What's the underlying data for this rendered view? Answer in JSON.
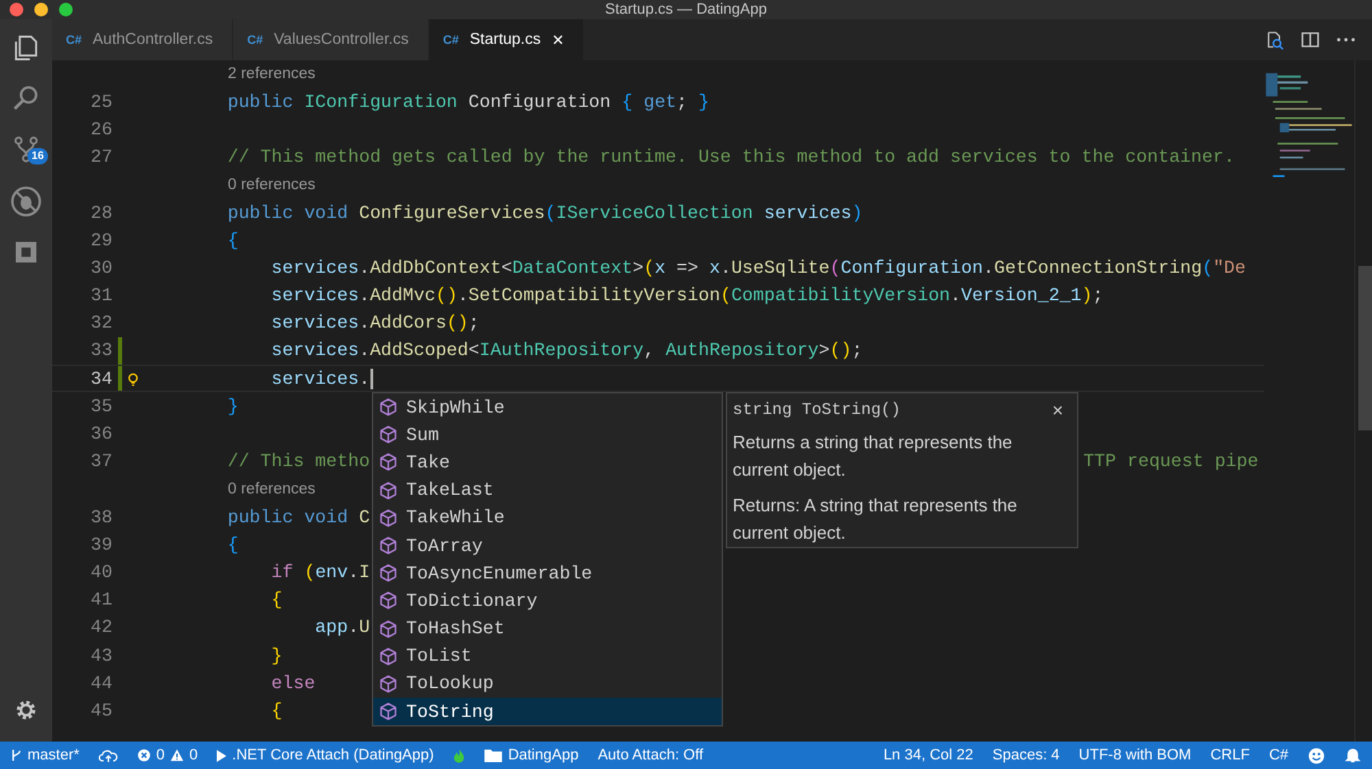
{
  "window": {
    "title": "Startup.cs — DatingApp"
  },
  "activity_bar": {
    "source_control_badge": "16"
  },
  "tabs": [
    {
      "icon": "C#",
      "label": "AuthController.cs",
      "selected": false
    },
    {
      "icon": "C#",
      "label": "ValuesController.cs",
      "selected": false
    },
    {
      "icon": "C#",
      "label": "Startup.cs",
      "selected": true,
      "close": "✕"
    }
  ],
  "editor": {
    "lines": [
      {
        "kind": "codelens",
        "text": "2 references"
      },
      {
        "kind": "code",
        "number": "25",
        "current": false,
        "changed": false,
        "tokens": [
          {
            "text": "        public ",
            "kind": "keyword"
          },
          {
            "text": "IConfiguration",
            "kind": "type"
          },
          {
            "text": " Configuration ",
            "kind": "plain"
          },
          {
            "text": "{",
            "kind": "brace3"
          },
          {
            "text": " get",
            "kind": "keyword"
          },
          {
            "text": "; ",
            "kind": "plain"
          },
          {
            "text": "}",
            "kind": "brace3"
          }
        ]
      },
      {
        "kind": "code",
        "number": "26",
        "current": false,
        "changed": false
      },
      {
        "kind": "code",
        "number": "27",
        "current": false,
        "changed": false,
        "tokens": [
          {
            "text": "        // This method gets called by the runtime. Use this method to add services to the container.",
            "kind": "comment"
          }
        ]
      },
      {
        "kind": "codelens",
        "text": "0 references"
      },
      {
        "kind": "code",
        "number": "28",
        "current": false,
        "changed": false,
        "tokens": [
          {
            "text": "        public void ",
            "kind": "keyword"
          },
          {
            "text": "ConfigureServices",
            "kind": "function"
          },
          {
            "text": "(",
            "kind": "brace3"
          },
          {
            "text": "IServiceCollection",
            "kind": "type"
          },
          {
            "text": " services",
            "kind": "variable"
          },
          {
            "text": ")",
            "kind": "brace3"
          }
        ]
      },
      {
        "kind": "code",
        "number": "29",
        "current": false,
        "changed": false,
        "tokens": [
          {
            "text": "        {",
            "kind": "brace3"
          }
        ]
      },
      {
        "kind": "code",
        "number": "30",
        "current": false,
        "changed": false,
        "tokens": [
          {
            "text": "            services",
            "kind": "variable"
          },
          {
            "text": ".",
            "kind": "plain"
          },
          {
            "text": "AddDbContext",
            "kind": "function"
          },
          {
            "text": "<",
            "kind": "plain"
          },
          {
            "text": "DataContext",
            "kind": "type"
          },
          {
            "text": ">",
            "kind": "plain"
          },
          {
            "text": "(",
            "kind": "brace1"
          },
          {
            "text": "x",
            "kind": "variable"
          },
          {
            "text": " => ",
            "kind": "plain"
          },
          {
            "text": "x",
            "kind": "variable"
          },
          {
            "text": ".",
            "kind": "plain"
          },
          {
            "text": "UseSqlite",
            "kind": "function"
          },
          {
            "text": "(",
            "kind": "brace2"
          },
          {
            "text": "Configuration",
            "kind": "variable"
          },
          {
            "text": ".",
            "kind": "plain"
          },
          {
            "text": "GetConnectionString",
            "kind": "function"
          },
          {
            "text": "(",
            "kind": "brace3"
          },
          {
            "text": "\"De",
            "kind": "string"
          }
        ]
      },
      {
        "kind": "code",
        "number": "31",
        "current": false,
        "changed": false,
        "tokens": [
          {
            "text": "            services",
            "kind": "variable"
          },
          {
            "text": ".",
            "kind": "plain"
          },
          {
            "text": "AddMvc",
            "kind": "function"
          },
          {
            "text": "()",
            "kind": "brace1"
          },
          {
            "text": ".",
            "kind": "plain"
          },
          {
            "text": "SetCompatibilityVersion",
            "kind": "function"
          },
          {
            "text": "(",
            "kind": "brace1"
          },
          {
            "text": "CompatibilityVersion",
            "kind": "type"
          },
          {
            "text": ".",
            "kind": "plain"
          },
          {
            "text": "Version_2_1",
            "kind": "variable"
          },
          {
            "text": ")",
            "kind": "brace1"
          },
          {
            "text": ";",
            "kind": "plain"
          }
        ]
      },
      {
        "kind": "code",
        "number": "32",
        "current": false,
        "changed": false,
        "tokens": [
          {
            "text": "            services",
            "kind": "variable"
          },
          {
            "text": ".",
            "kind": "plain"
          },
          {
            "text": "AddCors",
            "kind": "function"
          },
          {
            "text": "()",
            "kind": "brace1"
          },
          {
            "text": ";",
            "kind": "plain"
          }
        ]
      },
      {
        "kind": "code",
        "number": "33",
        "current": false,
        "changed": true,
        "tokens": [
          {
            "text": "            services",
            "kind": "variable"
          },
          {
            "text": ".",
            "kind": "plain"
          },
          {
            "text": "AddScoped",
            "kind": "function"
          },
          {
            "text": "<",
            "kind": "plain"
          },
          {
            "text": "IAuthRepository",
            "kind": "type"
          },
          {
            "text": ", ",
            "kind": "plain"
          },
          {
            "text": "AuthRepository",
            "kind": "type"
          },
          {
            "text": ">",
            "kind": "plain"
          },
          {
            "text": "()",
            "kind": "brace1"
          },
          {
            "text": ";",
            "kind": "plain"
          }
        ]
      },
      {
        "kind": "code",
        "number": "34",
        "current": true,
        "changed": true,
        "tokens": [
          {
            "text": "            services",
            "kind": "variable"
          },
          {
            "text": ".",
            "kind": "plain"
          }
        ]
      },
      {
        "kind": "code",
        "number": "35",
        "current": false,
        "changed": false,
        "tokens": [
          {
            "text": "        }",
            "kind": "brace3"
          }
        ]
      },
      {
        "kind": "code",
        "number": "36",
        "current": false,
        "changed": false
      },
      {
        "kind": "code",
        "number": "37",
        "current": false,
        "changed": false,
        "tokens": [
          {
            "text": "        // This metho",
            "kind": "comment"
          }
        ],
        "tail": "TTP request pipe"
      },
      {
        "kind": "codelens",
        "text": "0 references"
      },
      {
        "kind": "code",
        "number": "38",
        "current": false,
        "changed": false,
        "tokens": [
          {
            "text": "        public void ",
            "kind": "keyword"
          },
          {
            "text": "C",
            "kind": "function"
          }
        ]
      },
      {
        "kind": "code",
        "number": "39",
        "current": false,
        "changed": false,
        "tokens": [
          {
            "text": "        {",
            "kind": "brace3"
          }
        ]
      },
      {
        "kind": "code",
        "number": "40",
        "current": false,
        "changed": false,
        "tokens": [
          {
            "text": "            if ",
            "kind": "control"
          },
          {
            "text": "(",
            "kind": "brace1"
          },
          {
            "text": "env",
            "kind": "variable"
          },
          {
            "text": ".",
            "kind": "plain"
          },
          {
            "text": "I",
            "kind": "function"
          }
        ]
      },
      {
        "kind": "code",
        "number": "41",
        "current": false,
        "changed": false,
        "tokens": [
          {
            "text": "            {",
            "kind": "brace1"
          }
        ]
      },
      {
        "kind": "code",
        "number": "42",
        "current": false,
        "changed": false,
        "tokens": [
          {
            "text": "                app",
            "kind": "variable"
          },
          {
            "text": ".",
            "kind": "plain"
          },
          {
            "text": "U",
            "kind": "function"
          }
        ]
      },
      {
        "kind": "code",
        "number": "43",
        "current": false,
        "changed": false,
        "tokens": [
          {
            "text": "            }",
            "kind": "brace1"
          }
        ]
      },
      {
        "kind": "code",
        "number": "44",
        "current": false,
        "changed": false,
        "tokens": [
          {
            "text": "            else",
            "kind": "control"
          }
        ]
      },
      {
        "kind": "code",
        "number": "45",
        "current": false,
        "changed": false,
        "tokens": [
          {
            "text": "            {",
            "kind": "brace1"
          }
        ]
      }
    ]
  },
  "suggest": {
    "items": [
      {
        "label": "SkipWhile",
        "selected": false
      },
      {
        "label": "Sum",
        "selected": false
      },
      {
        "label": "Take",
        "selected": false
      },
      {
        "label": "TakeLast",
        "selected": false
      },
      {
        "label": "TakeWhile",
        "selected": false
      },
      {
        "label": "ToArray",
        "selected": false
      },
      {
        "label": "ToAsyncEnumerable",
        "selected": false
      },
      {
        "label": "ToDictionary",
        "selected": false
      },
      {
        "label": "ToHashSet",
        "selected": false
      },
      {
        "label": "ToList",
        "selected": false
      },
      {
        "label": "ToLookup",
        "selected": false
      },
      {
        "label": "ToString",
        "selected": true
      }
    ],
    "details": {
      "signature": "string ToString()",
      "close": "×",
      "paragraphs": [
        "Returns a string that represents the current object.",
        "Returns: A string that represents the current object."
      ]
    }
  },
  "status_bar": {
    "branch": "master*",
    "errors": "0",
    "warnings": "0",
    "debug": ".NET Core Attach (DatingApp)",
    "folder": "DatingApp",
    "auto_attach": "Auto Attach: Off",
    "position": "Ln 34, Col 22",
    "indent": "Spaces: 4",
    "encoding": "UTF-8 with BOM",
    "eol": "CRLF",
    "language": "C#"
  }
}
